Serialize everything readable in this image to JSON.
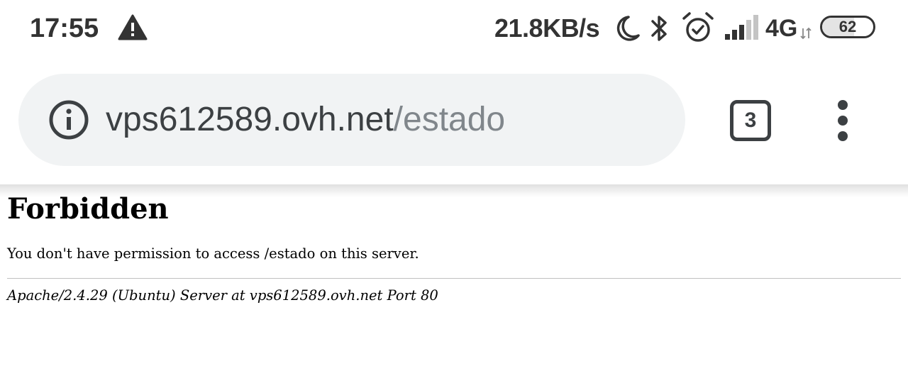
{
  "status_bar": {
    "time": "17:55",
    "warning_icon": "warning-triangle-icon",
    "speed": "21.8KB/s",
    "icons": [
      "moon-icon",
      "bluetooth-icon",
      "alarm-clock-icon",
      "signal-icon",
      "network-arrows-icon"
    ],
    "network": "4G",
    "battery": {
      "level": "62",
      "fraction": 0.62
    }
  },
  "browser": {
    "url": {
      "host": "vps612589.ovh.net",
      "path": "/estado"
    },
    "tab_count": "3",
    "colors": {
      "omnibox_bg": "#f1f3f4",
      "url_host": "#3c4043",
      "url_path": "#80868b"
    }
  },
  "page": {
    "heading": "Forbidden",
    "message": "You don't have permission to access /estado on this server.",
    "footer": "Apache/2.4.29 (Ubuntu) Server at vps612589.ovh.net Port 80"
  }
}
